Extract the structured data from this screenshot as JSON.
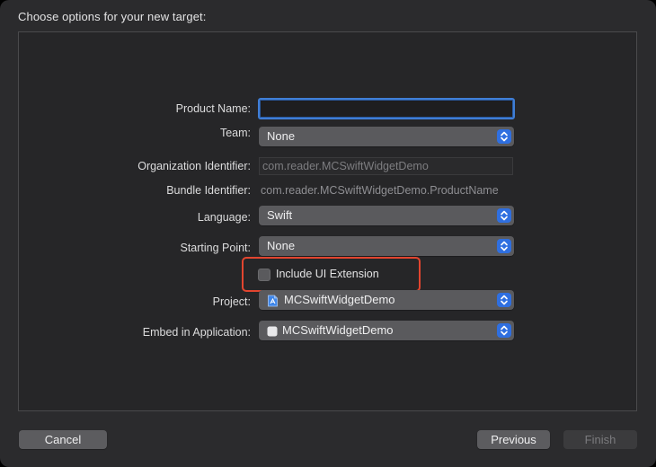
{
  "dialog": {
    "title": "Choose options for your new target:"
  },
  "form": {
    "product_name": {
      "label": "Product Name:",
      "value": ""
    },
    "team": {
      "label": "Team:",
      "value": "None"
    },
    "organization_identifier": {
      "label": "Organization Identifier:",
      "value": "com.reader.MCSwiftWidgetDemo"
    },
    "bundle_identifier": {
      "label": "Bundle Identifier:",
      "value": "com.reader.MCSwiftWidgetDemo.ProductName"
    },
    "language": {
      "label": "Language:",
      "value": "Swift"
    },
    "starting_point": {
      "label": "Starting Point:",
      "value": "None"
    },
    "include_ui_extension": {
      "label": "Include UI Extension",
      "checked": false
    },
    "project": {
      "label": "Project:",
      "value": "MCSwiftWidgetDemo"
    },
    "embed_in_application": {
      "label": "Embed in Application:",
      "value": "MCSwiftWidgetDemo"
    }
  },
  "buttons": {
    "cancel": "Cancel",
    "previous": "Previous",
    "finish": "Finish"
  },
  "colors": {
    "accent": "#2f6fe0",
    "highlight": "#e2452f"
  }
}
